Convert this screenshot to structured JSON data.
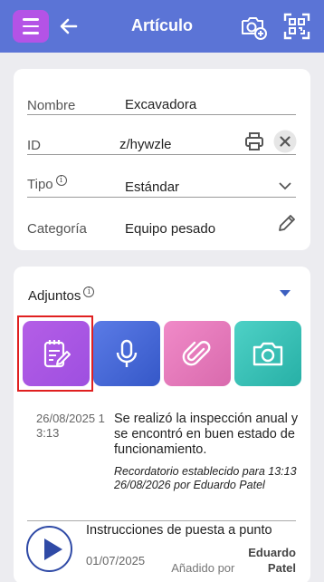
{
  "header": {
    "title": "Artículo",
    "menu_icon": "hamburger-menu-icon",
    "back_icon": "arrow-left-icon",
    "camera_add_icon": "camera-plus-icon",
    "scan_icon": "qr-scan-icon",
    "color": "#5b74d6"
  },
  "fields": {
    "nombre": {
      "label": "Nombre",
      "value": "Excavadora"
    },
    "id": {
      "label": "ID",
      "value": "z/hywzle"
    },
    "tipo": {
      "label": "Tipo",
      "value": "Estándar",
      "info": "i"
    },
    "categoria": {
      "label": "Categoría",
      "value": "Equipo pesado"
    }
  },
  "attachments": {
    "title": "Adjuntos",
    "info": "i",
    "tiles": [
      {
        "name": "note",
        "icon": "note-edit-icon",
        "color": "#a955e4"
      },
      {
        "name": "audio",
        "icon": "microphone-icon",
        "color": "#4a6bd8"
      },
      {
        "name": "file",
        "icon": "paperclip-icon",
        "color": "#e47cbb"
      },
      {
        "name": "photo",
        "icon": "camera-icon",
        "color": "#3bc1b6"
      }
    ],
    "note": {
      "date": "26/08/2025 13:13",
      "text": "Se realizó la inspección anual y se encontró en buen estado de funcionamiento.",
      "reminder": "Recordatorio establecido para 13:13 26/08/2026 por Eduardo Patel"
    },
    "audio": {
      "title": "Instrucciones de puesta a punto",
      "date": "01/07/2025",
      "added_prefix": "Añadido por",
      "added_by": "Eduardo Patel"
    }
  }
}
